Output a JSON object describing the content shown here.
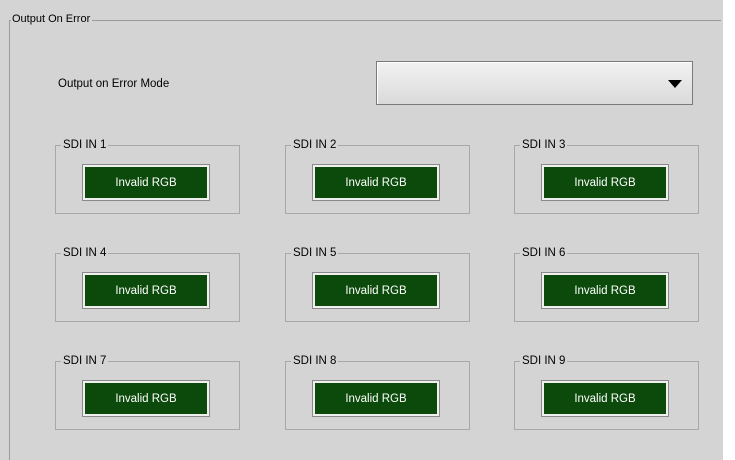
{
  "group": {
    "title": "Output On Error"
  },
  "mode": {
    "label": "Output on Error Mode",
    "value": ""
  },
  "inputs": [
    {
      "label": "SDI IN 1",
      "status": "Invalid RGB"
    },
    {
      "label": "SDI IN 2",
      "status": "Invalid RGB"
    },
    {
      "label": "SDI IN 3",
      "status": "Invalid RGB"
    },
    {
      "label": "SDI IN 4",
      "status": "Invalid RGB"
    },
    {
      "label": "SDI IN 5",
      "status": "Invalid RGB"
    },
    {
      "label": "SDI IN 6",
      "status": "Invalid RGB"
    },
    {
      "label": "SDI IN 7",
      "status": "Invalid RGB"
    },
    {
      "label": "SDI IN 8",
      "status": "Invalid RGB"
    },
    {
      "label": "SDI IN 9",
      "status": "Invalid RGB"
    }
  ],
  "colors": {
    "status_bg": "#0b4a0b",
    "status_text": "#ffffff",
    "panel_bg": "#d4d4d4"
  }
}
